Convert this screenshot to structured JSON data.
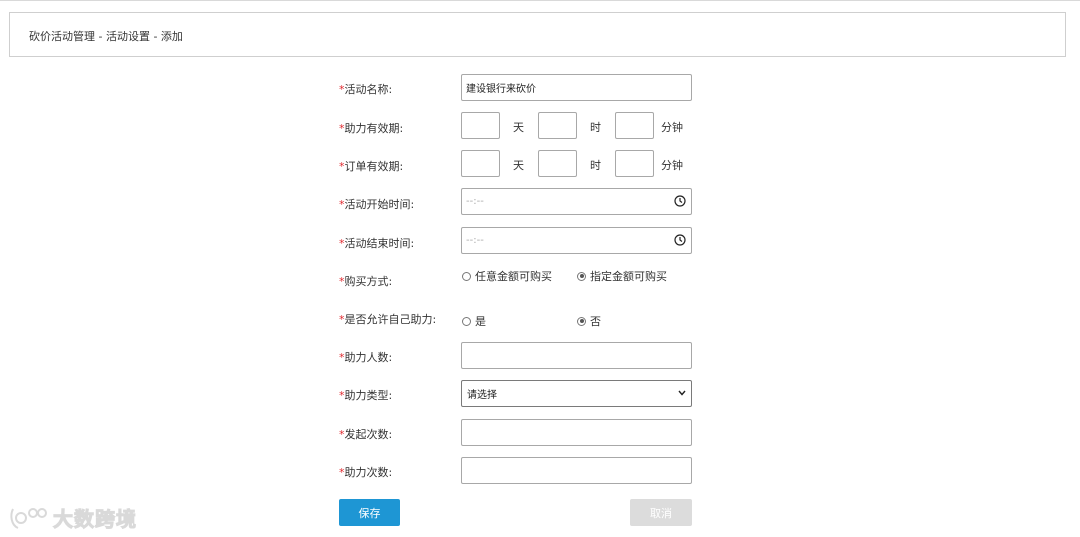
{
  "breadcrumb": "砍价活动管理 - 活动设置 - 添加",
  "required_mark": "*",
  "fields": {
    "activity_name": {
      "label": "活动名称:",
      "value": "建设银行来砍价"
    },
    "assist_validity": {
      "label": "助力有效期:",
      "unit_day": "天",
      "unit_hour": "时",
      "unit_minute": "分钟"
    },
    "order_validity": {
      "label": "订单有效期:",
      "unit_day": "天",
      "unit_hour": "时",
      "unit_minute": "分钟"
    },
    "start_time": {
      "label": "活动开始时间:",
      "placeholder": "--:--"
    },
    "end_time": {
      "label": "活动结束时间:",
      "placeholder": "--:--"
    },
    "purchase_method": {
      "label": "购买方式:",
      "option_any": "任意金额可购买",
      "option_fixed": "指定金额可购买",
      "selected": "option_fixed"
    },
    "allow_self_assist": {
      "label": "是否允许自己助力:",
      "option_yes": "是",
      "option_no": "否",
      "selected": "option_no"
    },
    "assist_people": {
      "label": "助力人数:",
      "value": ""
    },
    "assist_type": {
      "label": "助力类型:",
      "selected": "请选择"
    },
    "launch_count": {
      "label": "发起次数:",
      "value": ""
    },
    "assist_count": {
      "label": "助力次数:",
      "value": ""
    }
  },
  "buttons": {
    "save": "保存",
    "cancel": "取消"
  },
  "watermark": "大数跨境",
  "colors": {
    "primary": "#1e96d4",
    "required": "#e0282e",
    "disabled": "#dcdcdc"
  }
}
